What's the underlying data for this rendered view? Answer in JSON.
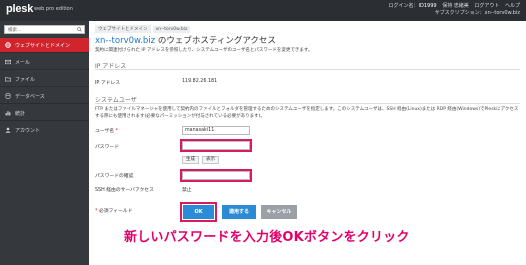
{
  "topbar": {
    "logo": "plesk",
    "logo_sub": "web pro edition",
    "login_label": "ログイン名：",
    "login_id": "ID1999",
    "user_name": "保持 忠緒美",
    "logout": "ログアウト",
    "help": "ヘルプ",
    "subscription_label": "サブスクリプション：",
    "subscription": "xn--torv0w.biz"
  },
  "sidebar": {
    "search_placeholder": "検索...",
    "items": [
      {
        "label": "ウェブサイトとドメイン",
        "icon": "globe-icon",
        "active": true
      },
      {
        "label": "メール",
        "icon": "mail-icon",
        "active": false
      },
      {
        "label": "ファイル",
        "icon": "folder-icon",
        "active": false
      },
      {
        "label": "データベース",
        "icon": "database-icon",
        "active": false
      },
      {
        "label": "統計",
        "icon": "stats-icon",
        "active": false
      },
      {
        "label": "アカウント",
        "icon": "account-icon",
        "active": false
      }
    ]
  },
  "main": {
    "breadcrumb": [
      "ウェブサイトとドメイン",
      "xn--torv0w.biz"
    ],
    "title_domain": "xn--torv0w.biz",
    "title_rest": " のウェブホスティングアクセス",
    "description": "契約に関連付けられた IP アドレスを参照したり、システムユーザのユーザ名とパスワードを変更できます。",
    "ip_section": "IP アドレス",
    "ip_label": "IP アドレス",
    "ip_value": "119.82.26.181",
    "sysuser_section": "システムユーザ",
    "sysuser_desc": "FTP またはファイルマネージャを使用して契約内のファイルとフォルダを管理するためのシステムユーザを指定します。このシステムユーザは、SSH 経由(Linux)または RDP 経由(Windows)でPleskにアクセスする際にも使用されます(必要なパーミッションが付与されている必要があります)。",
    "username_label": "ユーザ名",
    "username_value": "manasaki11",
    "password_label": "パスワード",
    "password_value": "",
    "generate_btn": "生成",
    "show_btn": "表示",
    "confirm_label": "パスワードの確認",
    "confirm_value": "",
    "ssh_label": "SSH 経由のサーバアクセス",
    "ssh_value": "禁止",
    "required_note": "必須フィールド",
    "required_mark": "*",
    "ok_btn": "OK",
    "apply_btn": "適用する",
    "cancel_btn": "キャンセル"
  },
  "instruction": "新しいパスワードを入力後OKボタンをクリック",
  "colors": {
    "accent_red": "#d1252d",
    "primary_blue": "#2b8bd6",
    "highlight_pink": "#d81b60",
    "instruction_pink": "#e4006a"
  }
}
